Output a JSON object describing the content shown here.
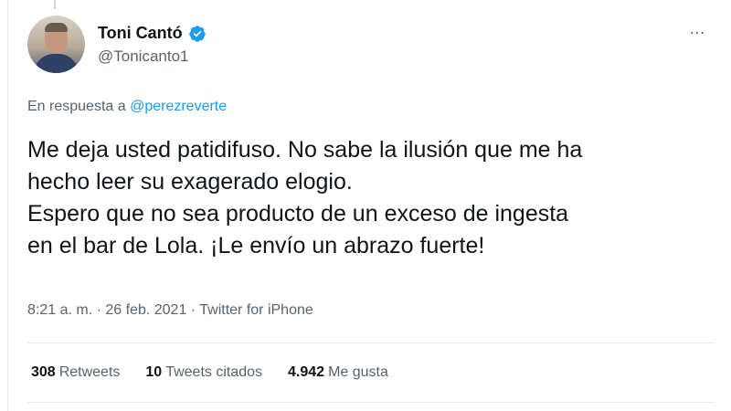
{
  "author": {
    "name": "Toni Cantó",
    "handle": "@Tonicanto1",
    "verified_icon": "verified-badge-icon",
    "verified_color": "#1d9bf0"
  },
  "reply": {
    "prefix": "En respuesta a",
    "mention": "@perezreverte"
  },
  "body": {
    "lines": [
      "Me deja usted patidifuso. No sabe la ilusión que me ha",
      "hecho leer su exagerado elogio.",
      "Espero que no sea producto de un exceso de ingesta",
      "en el bar de Lola. ¡Le envío un abrazo fuerte!"
    ]
  },
  "meta": {
    "time": "8:21 a. m. · 26 feb. 2021 · ",
    "source": "Twitter for iPhone"
  },
  "stats": {
    "retweets_count": "308",
    "retweets_label": "Retweets",
    "quotes_count": "10",
    "quotes_label": "Tweets citados",
    "likes_count": "4.942",
    "likes_label": "Me gusta"
  },
  "more_icon": "…"
}
